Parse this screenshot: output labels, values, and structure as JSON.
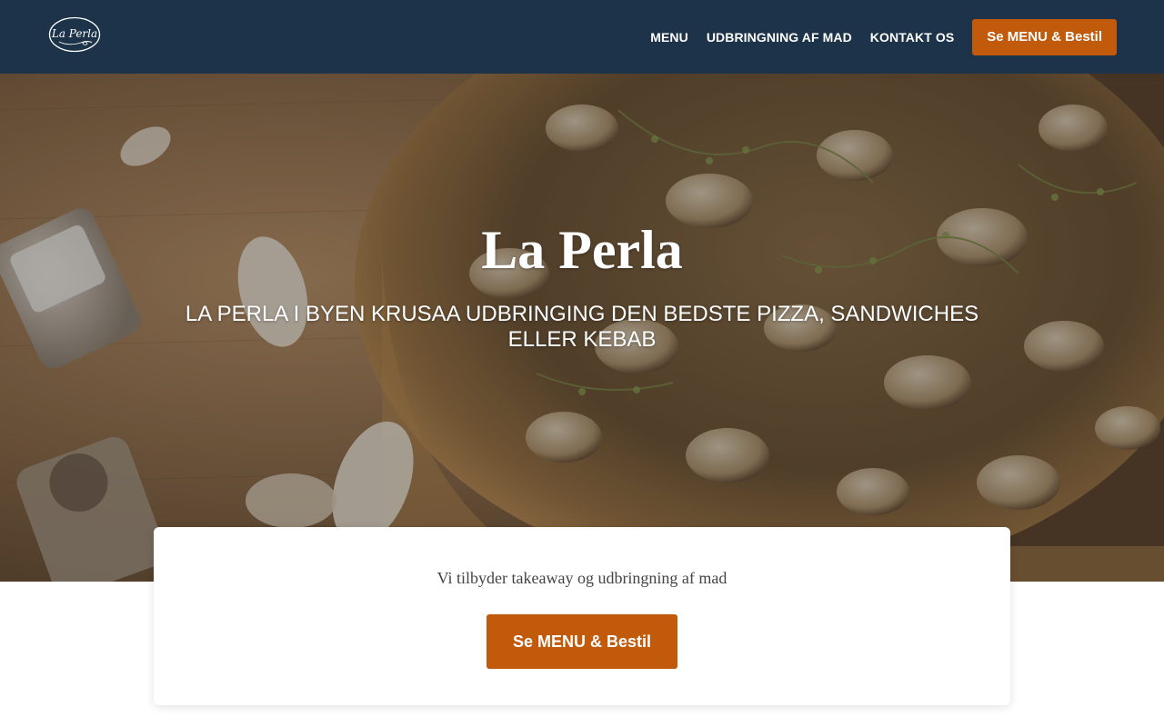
{
  "header": {
    "logo_text": "La Perla",
    "nav": [
      {
        "label": "MENU"
      },
      {
        "label": "UDBRINGNING AF MAD"
      },
      {
        "label": "KONTAKT OS"
      }
    ],
    "cta_label": "Se MENU & Bestil"
  },
  "hero": {
    "title": "La Perla",
    "subtitle": "LA PERLA I BYEN KRUSAA UDBRINGING DEN BEDSTE PIZZA, SANDWICHES ELLER KEBAB"
  },
  "card": {
    "text": "Vi tilbyder takeaway og udbringning af mad",
    "cta_label": "Se MENU & Bestil"
  },
  "colors": {
    "header_bg": "#1c3349",
    "accent": "#c25a0c",
    "text_white": "#ffffff",
    "card_text": "#444444"
  },
  "icons": {
    "logo": "la-perla-logo"
  }
}
